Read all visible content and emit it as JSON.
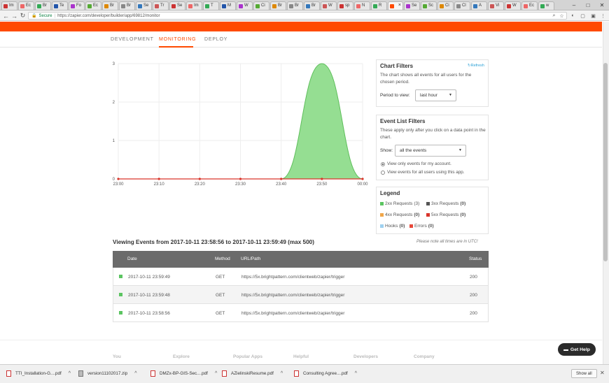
{
  "browser": {
    "tabs": [
      {
        "title": "Im"
      },
      {
        "title": "Ec"
      },
      {
        "title": "Br"
      },
      {
        "title": "Te"
      },
      {
        "title": "Fo"
      },
      {
        "title": "Ec"
      },
      {
        "title": "Br"
      },
      {
        "title": "Br"
      },
      {
        "title": "Se"
      },
      {
        "title": "Tr"
      },
      {
        "title": "Se"
      },
      {
        "title": "Im"
      },
      {
        "title": "T"
      },
      {
        "title": "M"
      },
      {
        "title": "W"
      },
      {
        "title": "Ci"
      },
      {
        "title": "Br"
      },
      {
        "title": "Br"
      },
      {
        "title": "Br"
      },
      {
        "title": "W"
      },
      {
        "title": "sp"
      },
      {
        "title": "N"
      },
      {
        "title": "R"
      },
      {
        "title": "",
        "active": true
      },
      {
        "title": "Se"
      },
      {
        "title": "Sc"
      },
      {
        "title": "Ci"
      },
      {
        "title": "Cl"
      },
      {
        "title": "A"
      },
      {
        "title": "Vi"
      },
      {
        "title": "W"
      },
      {
        "title": "Ec"
      },
      {
        "title": "w"
      }
    ],
    "secure_label": "Secure",
    "url": "https://zapier.com/developer/builder/app/69812/monitor"
  },
  "subnav": {
    "tabs": [
      "DEVELOPMENT",
      "MONITORING",
      "DEPLOY"
    ],
    "active": "MONITORING"
  },
  "chart_data": {
    "type": "area",
    "x": [
      "23:00",
      "23:10",
      "23:20",
      "23:30",
      "23:40",
      "23:50",
      "00:00"
    ],
    "series": [
      {
        "values": [
          0,
          0,
          0,
          0,
          0,
          3,
          0
        ],
        "color": "#8fdc8c"
      }
    ],
    "y_ticks": [
      "0",
      "1",
      "2",
      "3"
    ],
    "ylim": [
      0,
      3
    ],
    "grid": true,
    "legend": "none"
  },
  "chart_filters": {
    "title": "Chart Filters",
    "refresh_label": "Refresh",
    "description": "The chart shows all events for all users for the chosen period.",
    "period_label": "Period to view:",
    "period_value": "last hour"
  },
  "event_filters": {
    "title": "Event List Filters",
    "description": "These apply only after you click on a data point in the chart.",
    "show_label": "Show:",
    "show_value": "all the events",
    "radio_options": [
      "View only events for my account.",
      "View events for all users using this app."
    ]
  },
  "legend": {
    "title": "Legend",
    "items": [
      {
        "label": "2xx Requests",
        "count": "(3)",
        "color": "#5bc461"
      },
      {
        "label": "3xx Requests",
        "count": "(0)",
        "color": "#555555"
      },
      {
        "label": "4xx Requests",
        "count": "(0)",
        "color": "#f0a64a"
      },
      {
        "label": "5xx Requests",
        "count": "(0)",
        "color": "#d9352b"
      },
      {
        "label": "Hooks",
        "count": "(0)",
        "color": "#9fd1f0"
      },
      {
        "label": "Errors",
        "count": "(0)",
        "color": "#e8483a"
      }
    ]
  },
  "events": {
    "title": "Viewing Events from 2017-10-11 23:58:56 to 2017-10-11 23:59:49 (max 500)",
    "utc_note": "Please note all times are in UTC!",
    "columns": [
      "Date",
      "Method",
      "URL/Path",
      "Status"
    ],
    "rows": [
      {
        "date": "2017-10-11 23:59:49",
        "method": "GET",
        "url": "https://5x.brightpattern.com/clientweb/zapier/trigger",
        "status": "200"
      },
      {
        "date": "2017-10-11 23:59:48",
        "method": "GET",
        "url": "https://5x.brightpattern.com/clientweb/zapier/trigger",
        "status": "200"
      },
      {
        "date": "2017-10-11 23:58:56",
        "method": "GET",
        "url": "https://5x.brightpattern.com/clientweb/zapier/trigger",
        "status": "200"
      }
    ]
  },
  "footer": {
    "columns": [
      "You",
      "Explore",
      "Popular Apps",
      "Helpful",
      "Developers",
      "Company"
    ]
  },
  "get_help_label": "Get Help",
  "downloads": {
    "items": [
      "TTI_Installation-G....pdf",
      "version11102017.zip",
      "DMZx-BP-GIS-Sec....pdf",
      "AZielinskiResume.pdf",
      "Consulting Agree....pdf"
    ],
    "show_all_label": "Show all"
  }
}
